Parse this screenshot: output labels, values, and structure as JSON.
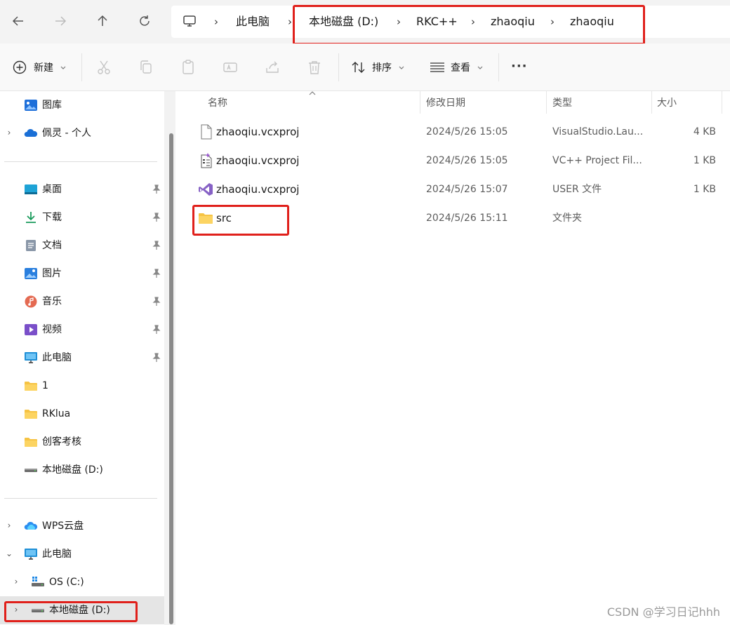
{
  "address_bar": {
    "nav": {
      "back_icon": "arrow-left",
      "forward_icon": "arrow-right",
      "up_icon": "arrow-up",
      "refresh_icon": "refresh"
    },
    "breadcrumb": [
      "此电脑",
      "本地磁盘 (D:)",
      "RKC++",
      "zhaoqiu",
      "zhaoqiu"
    ],
    "separator": "›"
  },
  "toolbar": {
    "new_label": "新建",
    "sort_label": "排序",
    "view_label": "查看",
    "more_label": "···"
  },
  "sidebar": {
    "top_items": [
      {
        "label": "图库",
        "icon": "gallery-icon"
      },
      {
        "label": "佩灵 - 个人",
        "icon": "onedrive-icon"
      }
    ],
    "quick_access": [
      {
        "label": "桌面",
        "icon": "desktop-icon",
        "pinned": true
      },
      {
        "label": "下载",
        "icon": "download-icon",
        "pinned": true
      },
      {
        "label": "文档",
        "icon": "documents-icon",
        "pinned": true
      },
      {
        "label": "图片",
        "icon": "pictures-icon",
        "pinned": true
      },
      {
        "label": "音乐",
        "icon": "music-icon",
        "pinned": true
      },
      {
        "label": "视频",
        "icon": "videos-icon",
        "pinned": true
      },
      {
        "label": "此电脑",
        "icon": "computer-icon",
        "pinned": true
      },
      {
        "label": "1",
        "icon": "folder-icon",
        "pinned": false
      },
      {
        "label": "RKlua",
        "icon": "folder-icon",
        "pinned": false
      },
      {
        "label": "创客考核",
        "icon": "folder-icon",
        "pinned": false
      },
      {
        "label": "本地磁盘 (D:)",
        "icon": "drive-icon",
        "pinned": false
      }
    ],
    "tree": [
      {
        "label": "WPS云盘",
        "icon": "cloud-icon",
        "expanded": false
      },
      {
        "label": "此电脑",
        "icon": "computer-icon",
        "expanded": true
      },
      {
        "label": "OS (C:)",
        "icon": "os-drive-icon",
        "expanded": false
      },
      {
        "label": "本地磁盘 (D:)",
        "icon": "drive-icon",
        "expanded": false,
        "selected": true
      }
    ]
  },
  "file_list": {
    "columns": [
      "名称",
      "修改日期",
      "类型",
      "大小"
    ],
    "rows": [
      {
        "name": "zhaoqiu.vcxproj",
        "date": "2024/5/26 15:05",
        "type": "VisualStudio.Lau...",
        "size": "4 KB",
        "icon": "file-icon"
      },
      {
        "name": "zhaoqiu.vcxproj",
        "date": "2024/5/26 15:05",
        "type": "VC++ Project Fil...",
        "size": "1 KB",
        "icon": "vcxproj-filters-icon"
      },
      {
        "name": "zhaoqiu.vcxproj",
        "date": "2024/5/26 15:07",
        "type": "USER 文件",
        "size": "1 KB",
        "icon": "visual-studio-icon"
      },
      {
        "name": "src",
        "date": "2024/5/26 15:11",
        "type": "文件夹",
        "size": "",
        "icon": "folder-icon"
      }
    ]
  },
  "watermark": "CSDN @学习日记hhh",
  "colors": {
    "highlight": "#e0201b",
    "folder": "#f6c343",
    "selected_bg": "#e5e5e5"
  }
}
